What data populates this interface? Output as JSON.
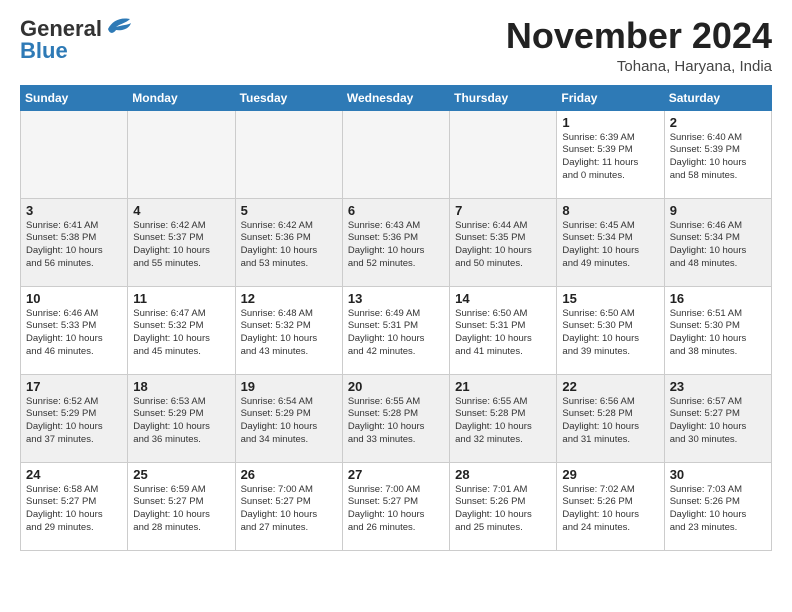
{
  "header": {
    "logo_line1": "General",
    "logo_line2": "Blue",
    "month_title": "November 2024",
    "location": "Tohana, Haryana, India"
  },
  "columns": [
    "Sunday",
    "Monday",
    "Tuesday",
    "Wednesday",
    "Thursday",
    "Friday",
    "Saturday"
  ],
  "rows": [
    {
      "parity": "odd",
      "cells": [
        {
          "day": "",
          "detail": "",
          "empty": true
        },
        {
          "day": "",
          "detail": "",
          "empty": true
        },
        {
          "day": "",
          "detail": "",
          "empty": true
        },
        {
          "day": "",
          "detail": "",
          "empty": true
        },
        {
          "day": "",
          "detail": "",
          "empty": true
        },
        {
          "day": "1",
          "detail": "Sunrise: 6:39 AM\nSunset: 5:39 PM\nDaylight: 11 hours\nand 0 minutes.",
          "empty": false
        },
        {
          "day": "2",
          "detail": "Sunrise: 6:40 AM\nSunset: 5:39 PM\nDaylight: 10 hours\nand 58 minutes.",
          "empty": false
        }
      ]
    },
    {
      "parity": "even",
      "cells": [
        {
          "day": "3",
          "detail": "Sunrise: 6:41 AM\nSunset: 5:38 PM\nDaylight: 10 hours\nand 56 minutes.",
          "empty": false
        },
        {
          "day": "4",
          "detail": "Sunrise: 6:42 AM\nSunset: 5:37 PM\nDaylight: 10 hours\nand 55 minutes.",
          "empty": false
        },
        {
          "day": "5",
          "detail": "Sunrise: 6:42 AM\nSunset: 5:36 PM\nDaylight: 10 hours\nand 53 minutes.",
          "empty": false
        },
        {
          "day": "6",
          "detail": "Sunrise: 6:43 AM\nSunset: 5:36 PM\nDaylight: 10 hours\nand 52 minutes.",
          "empty": false
        },
        {
          "day": "7",
          "detail": "Sunrise: 6:44 AM\nSunset: 5:35 PM\nDaylight: 10 hours\nand 50 minutes.",
          "empty": false
        },
        {
          "day": "8",
          "detail": "Sunrise: 6:45 AM\nSunset: 5:34 PM\nDaylight: 10 hours\nand 49 minutes.",
          "empty": false
        },
        {
          "day": "9",
          "detail": "Sunrise: 6:46 AM\nSunset: 5:34 PM\nDaylight: 10 hours\nand 48 minutes.",
          "empty": false
        }
      ]
    },
    {
      "parity": "odd",
      "cells": [
        {
          "day": "10",
          "detail": "Sunrise: 6:46 AM\nSunset: 5:33 PM\nDaylight: 10 hours\nand 46 minutes.",
          "empty": false
        },
        {
          "day": "11",
          "detail": "Sunrise: 6:47 AM\nSunset: 5:32 PM\nDaylight: 10 hours\nand 45 minutes.",
          "empty": false
        },
        {
          "day": "12",
          "detail": "Sunrise: 6:48 AM\nSunset: 5:32 PM\nDaylight: 10 hours\nand 43 minutes.",
          "empty": false
        },
        {
          "day": "13",
          "detail": "Sunrise: 6:49 AM\nSunset: 5:31 PM\nDaylight: 10 hours\nand 42 minutes.",
          "empty": false
        },
        {
          "day": "14",
          "detail": "Sunrise: 6:50 AM\nSunset: 5:31 PM\nDaylight: 10 hours\nand 41 minutes.",
          "empty": false
        },
        {
          "day": "15",
          "detail": "Sunrise: 6:50 AM\nSunset: 5:30 PM\nDaylight: 10 hours\nand 39 minutes.",
          "empty": false
        },
        {
          "day": "16",
          "detail": "Sunrise: 6:51 AM\nSunset: 5:30 PM\nDaylight: 10 hours\nand 38 minutes.",
          "empty": false
        }
      ]
    },
    {
      "parity": "even",
      "cells": [
        {
          "day": "17",
          "detail": "Sunrise: 6:52 AM\nSunset: 5:29 PM\nDaylight: 10 hours\nand 37 minutes.",
          "empty": false
        },
        {
          "day": "18",
          "detail": "Sunrise: 6:53 AM\nSunset: 5:29 PM\nDaylight: 10 hours\nand 36 minutes.",
          "empty": false
        },
        {
          "day": "19",
          "detail": "Sunrise: 6:54 AM\nSunset: 5:29 PM\nDaylight: 10 hours\nand 34 minutes.",
          "empty": false
        },
        {
          "day": "20",
          "detail": "Sunrise: 6:55 AM\nSunset: 5:28 PM\nDaylight: 10 hours\nand 33 minutes.",
          "empty": false
        },
        {
          "day": "21",
          "detail": "Sunrise: 6:55 AM\nSunset: 5:28 PM\nDaylight: 10 hours\nand 32 minutes.",
          "empty": false
        },
        {
          "day": "22",
          "detail": "Sunrise: 6:56 AM\nSunset: 5:28 PM\nDaylight: 10 hours\nand 31 minutes.",
          "empty": false
        },
        {
          "day": "23",
          "detail": "Sunrise: 6:57 AM\nSunset: 5:27 PM\nDaylight: 10 hours\nand 30 minutes.",
          "empty": false
        }
      ]
    },
    {
      "parity": "odd",
      "cells": [
        {
          "day": "24",
          "detail": "Sunrise: 6:58 AM\nSunset: 5:27 PM\nDaylight: 10 hours\nand 29 minutes.",
          "empty": false
        },
        {
          "day": "25",
          "detail": "Sunrise: 6:59 AM\nSunset: 5:27 PM\nDaylight: 10 hours\nand 28 minutes.",
          "empty": false
        },
        {
          "day": "26",
          "detail": "Sunrise: 7:00 AM\nSunset: 5:27 PM\nDaylight: 10 hours\nand 27 minutes.",
          "empty": false
        },
        {
          "day": "27",
          "detail": "Sunrise: 7:00 AM\nSunset: 5:27 PM\nDaylight: 10 hours\nand 26 minutes.",
          "empty": false
        },
        {
          "day": "28",
          "detail": "Sunrise: 7:01 AM\nSunset: 5:26 PM\nDaylight: 10 hours\nand 25 minutes.",
          "empty": false
        },
        {
          "day": "29",
          "detail": "Sunrise: 7:02 AM\nSunset: 5:26 PM\nDaylight: 10 hours\nand 24 minutes.",
          "empty": false
        },
        {
          "day": "30",
          "detail": "Sunrise: 7:03 AM\nSunset: 5:26 PM\nDaylight: 10 hours\nand 23 minutes.",
          "empty": false
        }
      ]
    }
  ]
}
